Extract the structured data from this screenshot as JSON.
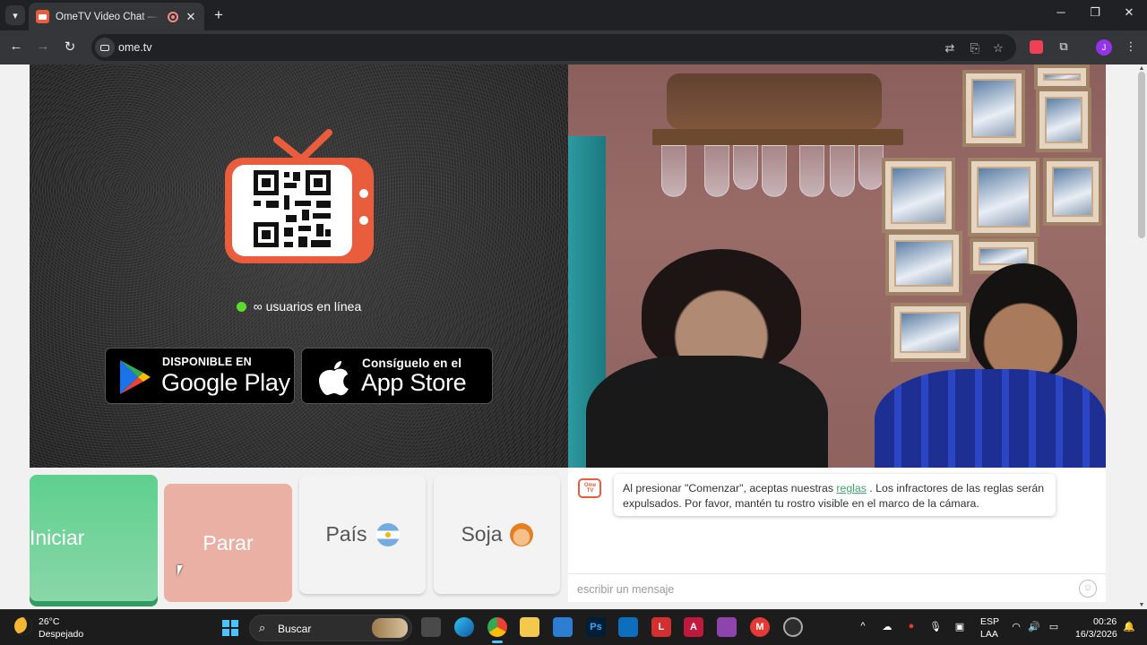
{
  "browser": {
    "tab_title": "OmeTV Video Chat — Alter",
    "url": "ome.tv",
    "new_tab": "+",
    "close_tab": "✕",
    "window_minimize": "─",
    "window_maximize": "❐",
    "window_close": "✕",
    "profile_initial": "J"
  },
  "page": {
    "online_count": "∞ usuarios en línea",
    "google_play": {
      "small": "DISPONIBLE EN",
      "big": "Google Play"
    },
    "app_store": {
      "small": "Consíguelo en el",
      "big": "App Store"
    },
    "buttons": {
      "start": "Iniciar",
      "stop": "Parar",
      "country": "País",
      "gender": "Soja"
    },
    "chat": {
      "logo_text": "Ome TV",
      "message_before": "Al presionar \"Comenzar\", aceptas nuestras",
      "message_link": "reglas",
      "message_after": ". Los infractores de las reglas serán expulsados. Por favor, mantén tu rostro visible en el marco de la cámara.",
      "input_placeholder": "escribir un mensaje"
    }
  },
  "taskbar": {
    "temperature": "26°C",
    "condition": "Despejado",
    "search_label": "Buscar",
    "lang_top": "ESP",
    "lang_bottom": "LAA",
    "time": "00:26",
    "date": "16/3/2026"
  },
  "colors": {
    "accent_green": "#5ed08e",
    "stop_pink": "#eab0a4",
    "ome_orange": "#e95c3c",
    "online_dot": "#5ddb2d"
  }
}
